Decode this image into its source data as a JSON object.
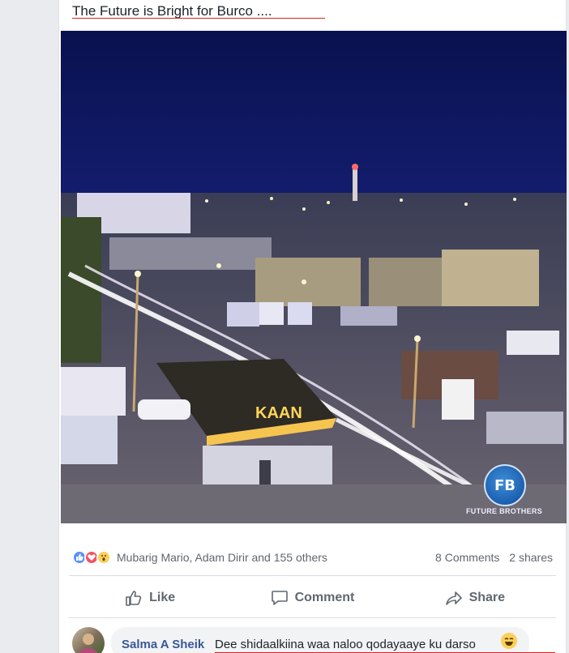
{
  "post": {
    "text": "The Future is Bright for Burco ...."
  },
  "photo": {
    "sign_text": "KAAN",
    "watermark_logo": "FB",
    "watermark_text": "FUTURE BROTHERS"
  },
  "reactions": {
    "icons": [
      "like-icon",
      "love-icon",
      "wow-icon"
    ],
    "reactors": "Mubarig Mario, Adam Dirir and 155 others",
    "comments": "8 Comments",
    "shares": "2 shares"
  },
  "actions": {
    "like": "Like",
    "comment": "Comment",
    "share": "Share"
  },
  "comment": {
    "author": "Salma A Sheik",
    "text": "Dee shidaalkiina waa naloo qodayaaye ku darso"
  },
  "colors": {
    "link": "#385898",
    "text": "#1d2129",
    "muted": "#606770",
    "like_blue": "#5890ff",
    "love_red": "#f25268",
    "wow_yellow": "#fcd058"
  }
}
